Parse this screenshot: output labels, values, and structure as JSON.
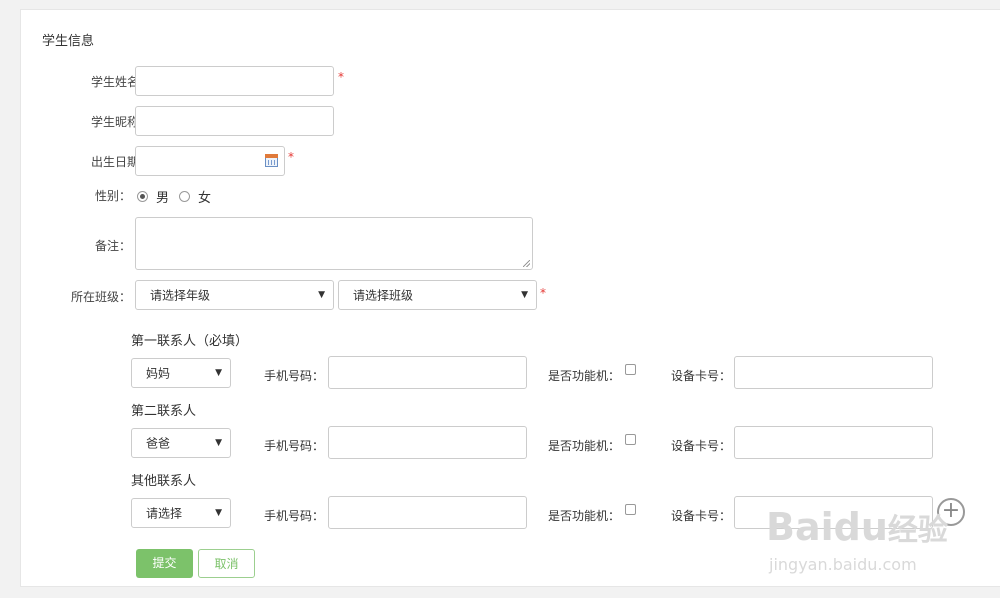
{
  "section_title": "学生信息",
  "fields": {
    "name_label": "学生姓名：",
    "nickname_label": "学生昵称：",
    "birthday_label": "出生日期：",
    "gender_label": "性别：",
    "gender_male": "男",
    "gender_female": "女",
    "gender_selected": "男",
    "remark_label": "备注：",
    "class_label": "所在班级：",
    "grade_select": "请选择年级",
    "class_select": "请选择班级",
    "required_mark": "*"
  },
  "contacts": {
    "phone_label": "手机号码：",
    "feature_label": "是否功能机：",
    "card_label": "设备卡号：",
    "groups": [
      {
        "title": "第一联系人（必填）",
        "relation": "妈妈"
      },
      {
        "title": "第二联系人",
        "relation": "爸爸"
      },
      {
        "title": "其他联系人",
        "relation": "请选择"
      }
    ]
  },
  "buttons": {
    "submit": "提交",
    "cancel": "取消"
  },
  "watermark": {
    "brand": "Baidu",
    "brand_cn": "经验",
    "url": "jingyan.baidu.com"
  },
  "colors": {
    "accent_green": "#7cc26a",
    "required_red": "#e53935"
  }
}
